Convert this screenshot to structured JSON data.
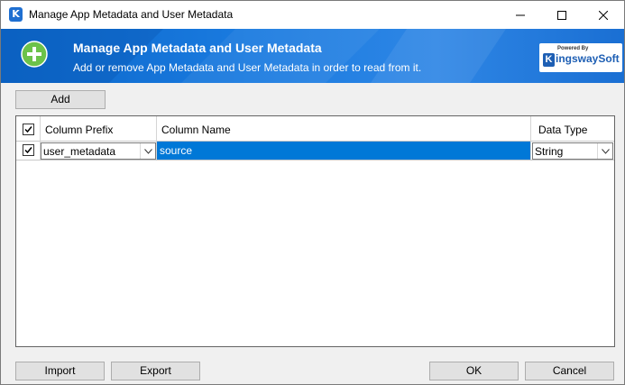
{
  "window": {
    "title": "Manage App Metadata and User Metadata"
  },
  "banner": {
    "title": "Manage App Metadata and User Metadata",
    "subtitle": "Add or remove App Metadata and User Metadata in order to read from it.",
    "logo": {
      "powered_by": "Powered By",
      "brand": "ingswaySoft",
      "brand_k": "K"
    }
  },
  "toolbar": {
    "add_label": "Add"
  },
  "grid": {
    "columns": [
      "Column Prefix",
      "Column Name",
      "Data Type"
    ],
    "rows": [
      {
        "checked": true,
        "prefix": "user_metadata",
        "name": "source",
        "type": "String"
      }
    ]
  },
  "footer": {
    "import_label": "Import",
    "export_label": "Export",
    "ok_label": "OK",
    "cancel_label": "Cancel"
  },
  "colors": {
    "banner": "#1a7be0",
    "selection": "#0078d7",
    "plus_green": "#6cc24a"
  }
}
